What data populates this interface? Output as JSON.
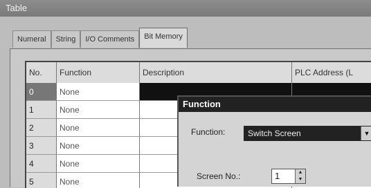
{
  "window": {
    "title": "Table"
  },
  "tabs": [
    "Numeral",
    "String",
    "I/O Comments",
    "Bit Memory"
  ],
  "grid": {
    "headers": {
      "no": "No.",
      "function": "Function",
      "description": "Description",
      "plc": "PLC Address (L"
    },
    "rows": [
      {
        "no": "0",
        "function": "None",
        "description": "",
        "plc": ""
      },
      {
        "no": "1",
        "function": "None",
        "description": "",
        "plc": ""
      },
      {
        "no": "2",
        "function": "None",
        "description": "",
        "plc": ""
      },
      {
        "no": "3",
        "function": "None",
        "description": "",
        "plc": ""
      },
      {
        "no": "4",
        "function": "None",
        "description": "",
        "plc": ""
      },
      {
        "no": "5",
        "function": "None",
        "description": "",
        "plc": ""
      }
    ]
  },
  "dialog": {
    "title": "Function",
    "function_label": "Function:",
    "function_value": "Switch Screen",
    "screen_label": "Screen No.:",
    "screen_value": "1"
  }
}
